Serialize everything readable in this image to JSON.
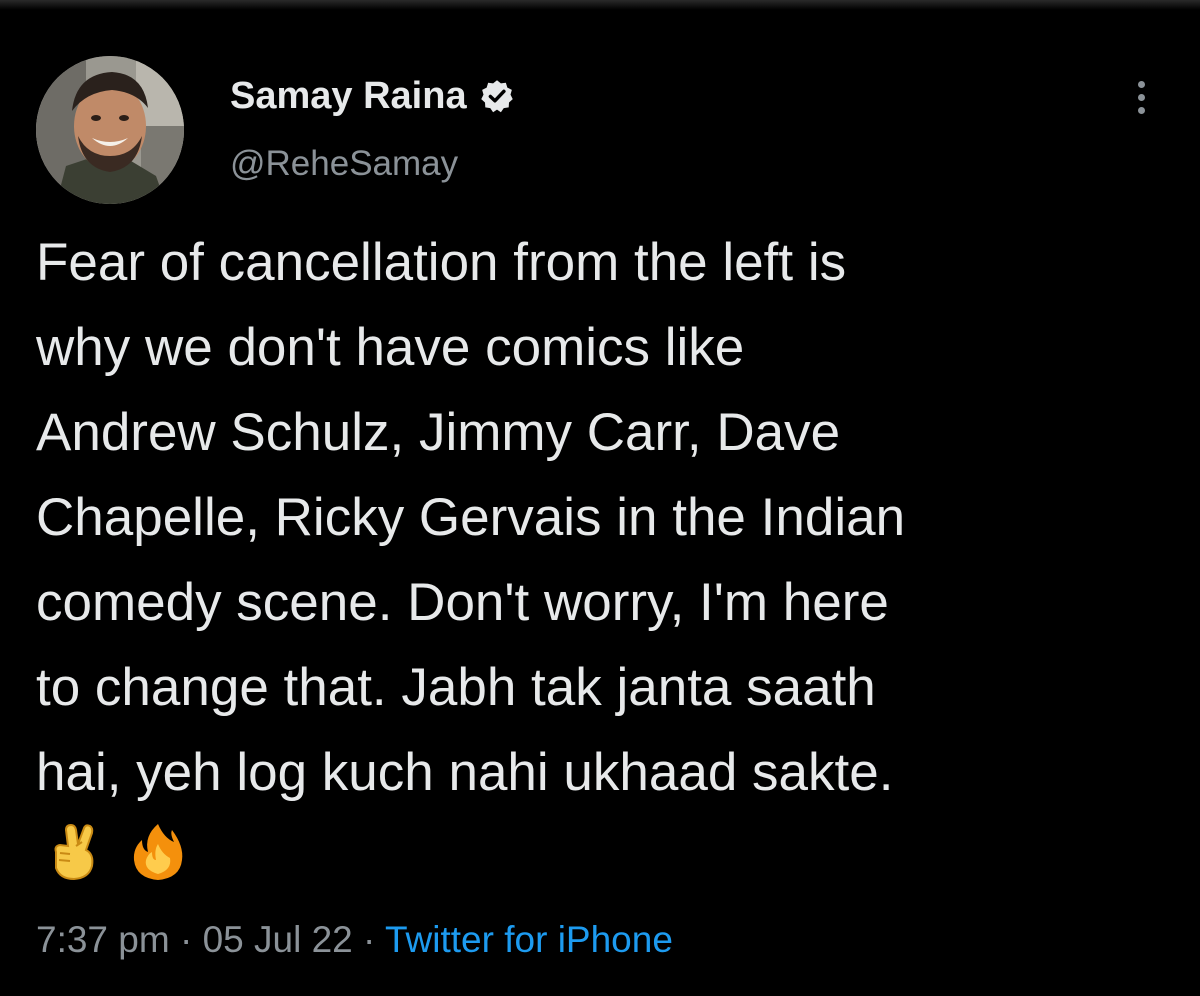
{
  "tweet": {
    "author": {
      "display_name": "Samay Raina",
      "handle": "@ReheSamay",
      "verified": true,
      "avatar_icon": "profile-photo-avatar"
    },
    "text_lines": [
      "Fear of cancellation from the left is",
      "why we don't have comics like",
      "Andrew Schulz, Jimmy Carr, Dave",
      "Chapelle, Ricky Gervais in the Indian",
      "comedy scene. Don't worry, I'm here",
      "to change that. Jabh tak janta saath",
      "hai, yeh log kuch nahi ukhaad sakte."
    ],
    "emojis": [
      "crossed-fingers-emoji",
      "fire-emoji"
    ],
    "time": "7:37 pm",
    "separator": "·",
    "date": "05 Jul 22",
    "source": "Twitter for iPhone"
  },
  "colors": {
    "background": "#000000",
    "text": "#e7e9ea",
    "secondary": "#8b9298",
    "accent": "#1d9bf0"
  },
  "more_menu_icon": "vertical-ellipsis-icon"
}
